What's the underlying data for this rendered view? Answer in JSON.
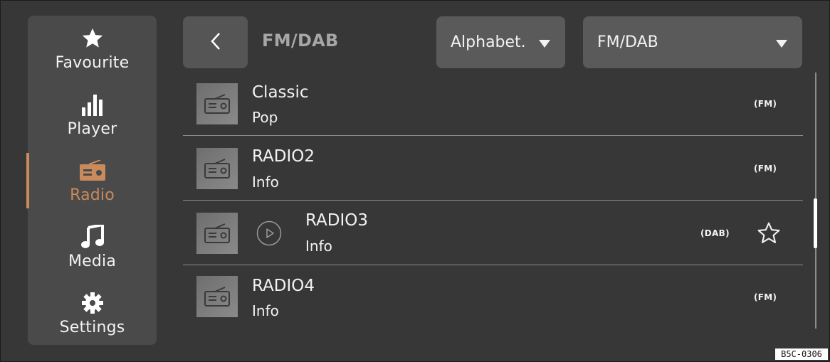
{
  "sidebar": {
    "items": [
      {
        "label": "Favourite",
        "icon": "star-icon"
      },
      {
        "label": "Player",
        "icon": "equalizer-bars-icon"
      },
      {
        "label": "Radio",
        "icon": "radio-icon",
        "active": true
      },
      {
        "label": "Media",
        "icon": "music-note-icon"
      },
      {
        "label": "Settings",
        "icon": "gear-icon"
      }
    ]
  },
  "header": {
    "title": "FM/DAB",
    "back_icon": "chevron-left-icon",
    "sort_dropdown": {
      "value": "Alphabet."
    },
    "source_dropdown": {
      "value": "FM/DAB"
    }
  },
  "stations": [
    {
      "name": "Classic",
      "sub": "Pop",
      "band": "(FM)"
    },
    {
      "name": "RADIO2",
      "sub": "Info",
      "band": "(FM)"
    },
    {
      "name": "RADIO3",
      "sub": "Info",
      "band": "(DAB)",
      "playing_control": "play-circle-icon",
      "favourite": "star-outline-icon"
    },
    {
      "name": "RADIO4",
      "sub": "Info",
      "band": "(FM)"
    }
  ],
  "code_label": "B5C-0306",
  "colors": {
    "background": "#373737",
    "sidebar": "#4a4a4a",
    "accent": "#c98a5c",
    "text": "#f2f2f2",
    "muted_title": "#a6a6a6"
  }
}
